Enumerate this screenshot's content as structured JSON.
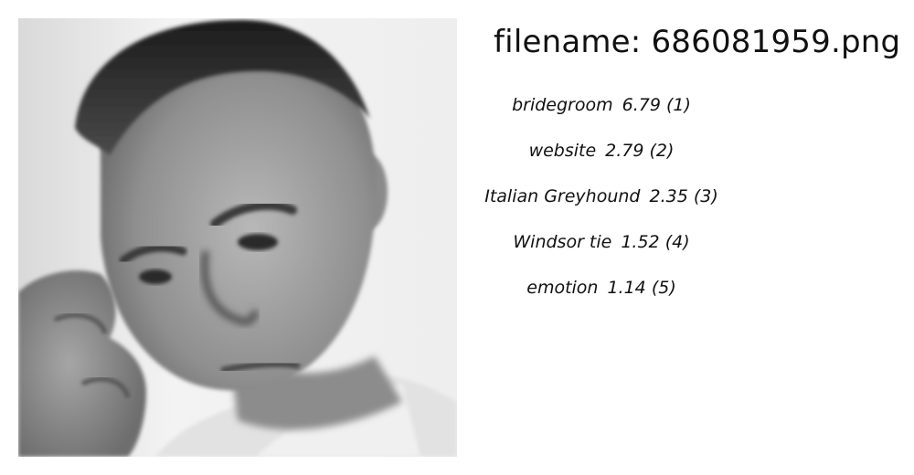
{
  "photo": {
    "icon": "grayscale-portrait-photo"
  },
  "filename": "filename: 686081959.png",
  "predictions": [
    {
      "label": "bridegroom",
      "score": "6.79 (1)"
    },
    {
      "label": "website",
      "score": "2.79 (2)"
    },
    {
      "label": "Italian Greyhound",
      "score": "2.35 (3)"
    },
    {
      "label": "Windsor tie",
      "score": "1.52 (4)"
    },
    {
      "label": "emotion",
      "score": "1.14 (5)"
    }
  ]
}
